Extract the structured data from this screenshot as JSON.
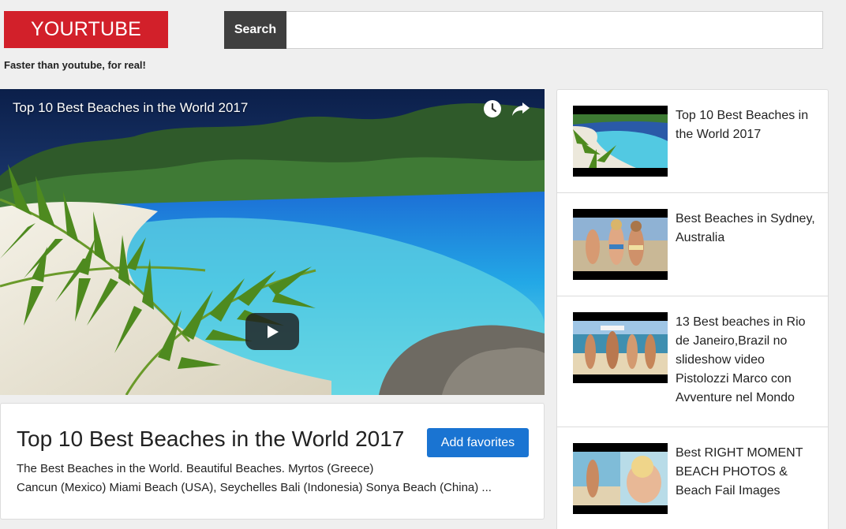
{
  "header": {
    "logo": "YOURTUBE",
    "tagline": "Faster than youtube, for real!",
    "search_button": "Search",
    "search_value": "",
    "search_placeholder": ""
  },
  "player": {
    "title": "Top 10 Best Beaches in the World 2017",
    "icons": [
      "watch-later-icon",
      "share-icon",
      "play-icon"
    ]
  },
  "video": {
    "title": "Top 10 Best Beaches in the World 2017",
    "favorite_button": "Add favorites",
    "description_line1": "The Best Beaches in the World. Beautiful Beaches. Myrtos (Greece)",
    "description_line2": "Cancun (Mexico) Miami Beach (USA), Seychelles Bali (Indonesia) Sonya Beach (China) ..."
  },
  "sidebar": {
    "items": [
      {
        "title": "Top 10 Best Beaches in the World 2017"
      },
      {
        "title": "Best Beaches in Sydney, Australia"
      },
      {
        "title": "13 Best beaches in Rio de Janeiro,Brazil no slideshow video Pistolozzi Marco con Avventure nel Mondo"
      },
      {
        "title": "Best RIGHT MOMENT BEACH PHOTOS & Beach Fail Images"
      }
    ]
  },
  "colors": {
    "brand_red": "#d2202a",
    "search_button_bg": "#3f3f3f",
    "favorite_blue": "#1a74d2",
    "page_bg": "#efefef"
  }
}
